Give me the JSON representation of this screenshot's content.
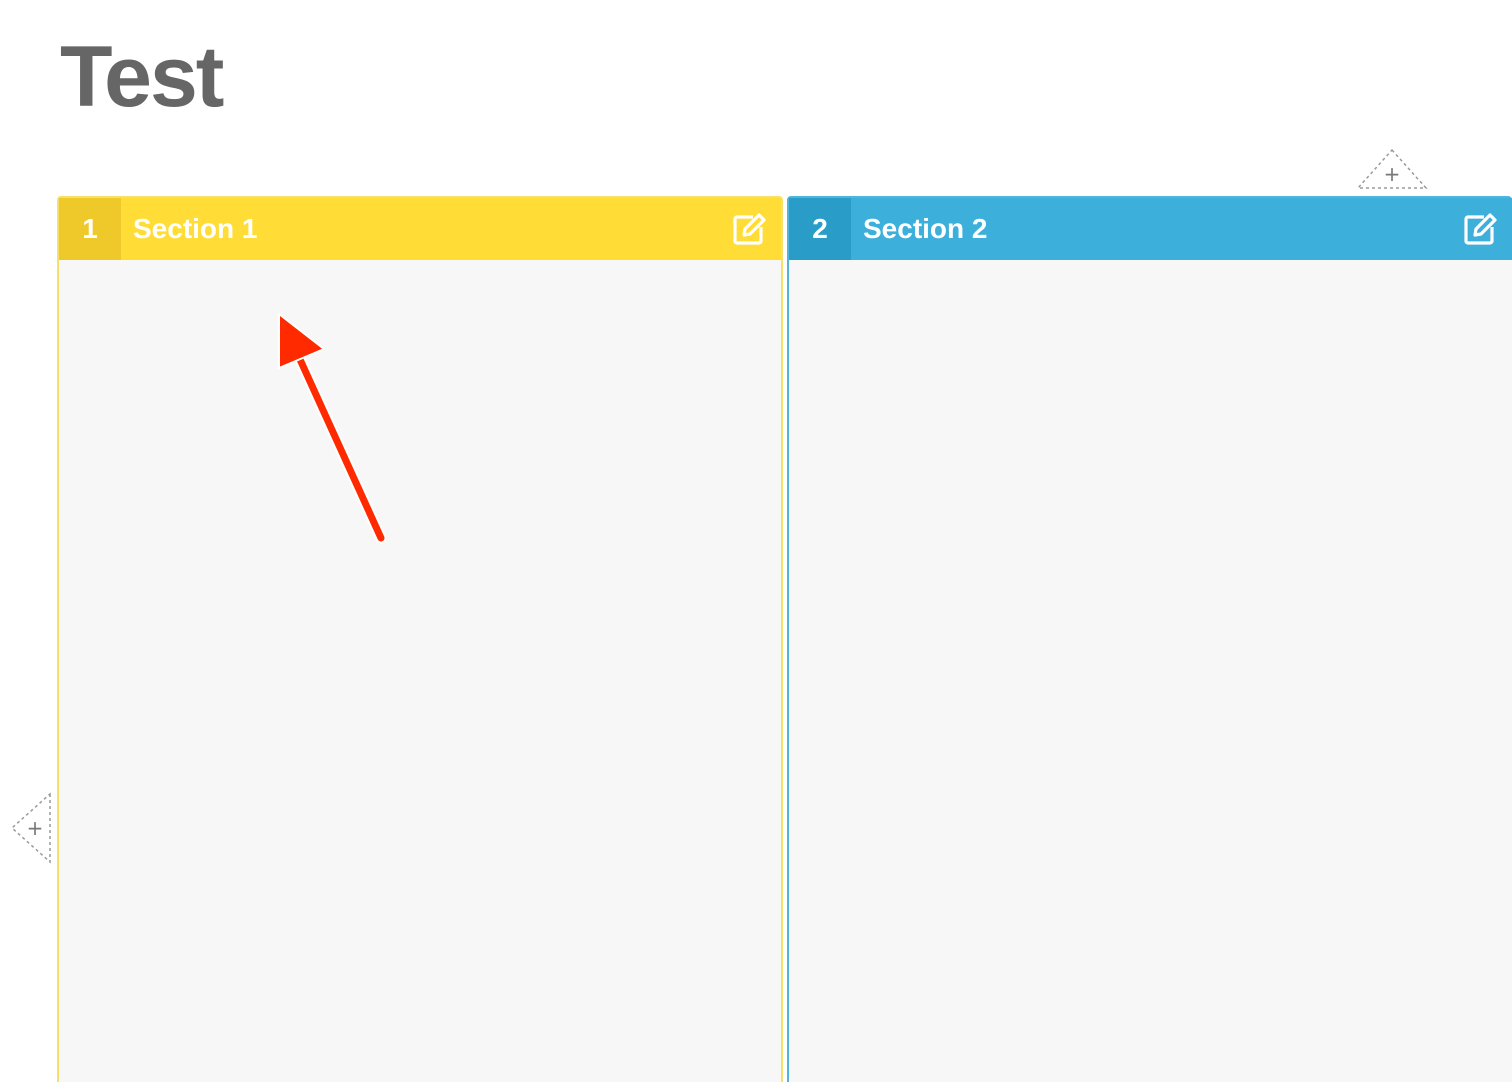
{
  "board": {
    "title": "Test"
  },
  "sections": [
    {
      "number": "1",
      "name": "Section 1",
      "color": "#ffdd36",
      "edit_icon": "edit-icon"
    },
    {
      "number": "2",
      "name": "Section 2",
      "color": "#3dafdb",
      "edit_icon": "edit-icon"
    }
  ],
  "controls": {
    "add_column_top_label": "+",
    "add_row_left_label": "+"
  },
  "annotation": {
    "arrow_color": "#ff2a00"
  }
}
